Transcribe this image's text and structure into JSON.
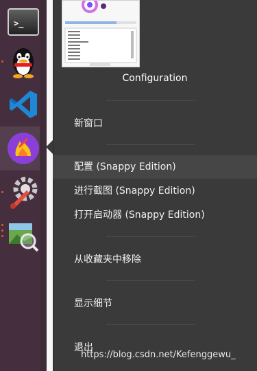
{
  "preview": {
    "title": "Configuration",
    "text_primary": "#333333"
  },
  "menu": {
    "items": [
      {
        "label": "新窗口"
      },
      {
        "label": "配置 (Snappy Edition)"
      },
      {
        "label": "进行截图 (Snappy Edition)"
      },
      {
        "label": "打开启动器 (Snappy Edition)"
      },
      {
        "label": "从收藏夹中移除"
      },
      {
        "label": "显示细节"
      },
      {
        "label": "退出"
      }
    ],
    "highlighted_index": 1
  },
  "dock": {
    "items": [
      {
        "icon": "terminal-icon"
      },
      {
        "icon": "qq-penguin-icon"
      },
      {
        "icon": "vscode-icon"
      },
      {
        "icon": "flameshot-icon"
      },
      {
        "icon": "system-tools-icon"
      },
      {
        "icon": "image-viewer-icon"
      }
    ]
  },
  "watermark": "https://blog.csdn.net/Kefenggewu_",
  "colors": {
    "dock_bg": "#452f3e",
    "menu_bg": "#3a3a3a",
    "highlight_bg": "#464646",
    "accent": "#e95420"
  }
}
